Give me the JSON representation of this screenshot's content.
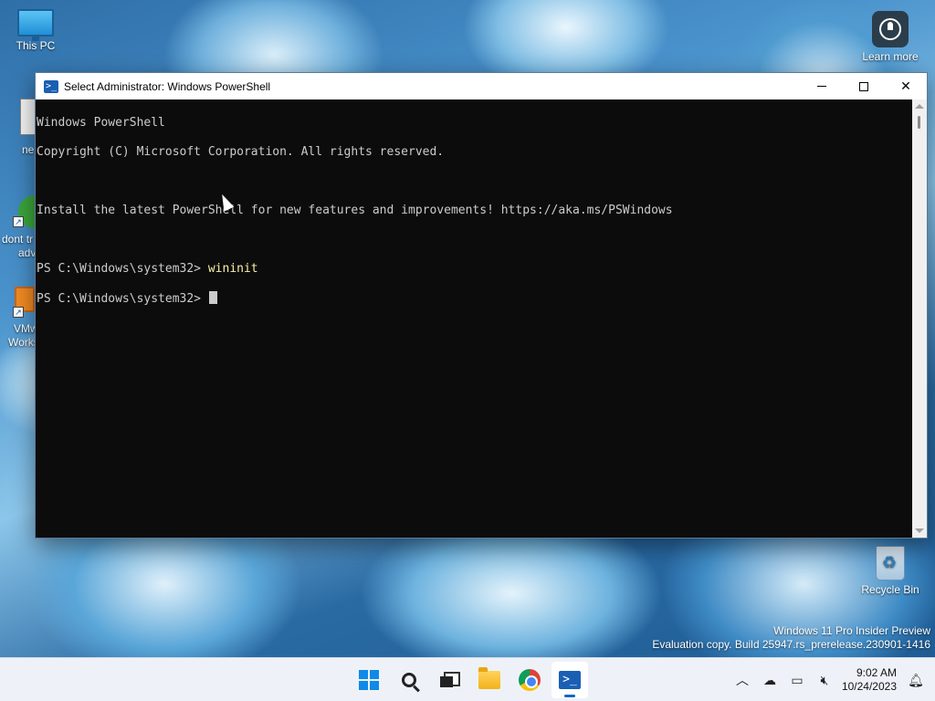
{
  "desktop": {
    "this_pc_label": "This PC",
    "learn_more_label": "Learn more",
    "recycle_bin_label": "Recycle Bin",
    "partial_labels": {
      "ne": "ne",
      "dont": "dont tr",
      "adv": "adv",
      "vmw": "VMw",
      "works": "Works"
    },
    "icons": [
      "this-pc-icon",
      "learn-more-icon",
      "recycle-bin-icon",
      "document-icon",
      "vmware-workstation-icon"
    ]
  },
  "watermark": {
    "line1": "Windows 11 Pro Insider Preview",
    "line2": "Evaluation copy. Build 25947.rs_prerelease.230901-1416"
  },
  "window": {
    "title": "Select Administrator: Windows PowerShell",
    "icon": "powershell-icon",
    "console": {
      "line1": "Windows PowerShell",
      "line2": "Copyright (C) Microsoft Corporation. All rights reserved.",
      "line3": "",
      "line4": "Install the latest PowerShell for new features and improvements! https://aka.ms/PSWindows",
      "line5": "",
      "prompt1": "PS C:\\Windows\\system32> ",
      "command1": "wininit",
      "prompt2": "PS C:\\Windows\\system32> "
    },
    "colors": {
      "console_bg": "#0c0c0c",
      "console_fg": "#cccccc",
      "command_fg": "#f9f1a5"
    }
  },
  "taskbar": {
    "apps": [
      "start-button",
      "search-button",
      "task-view-button",
      "file-explorer-button",
      "chrome-button",
      "powershell-button"
    ],
    "active_app": "powershell-button",
    "tray_icons": [
      "chevron-up-icon",
      "onedrive-icon",
      "network-icon",
      "volume-muted-icon",
      "notification-icon"
    ],
    "time": "9:02 AM",
    "date": "10/24/2023"
  }
}
